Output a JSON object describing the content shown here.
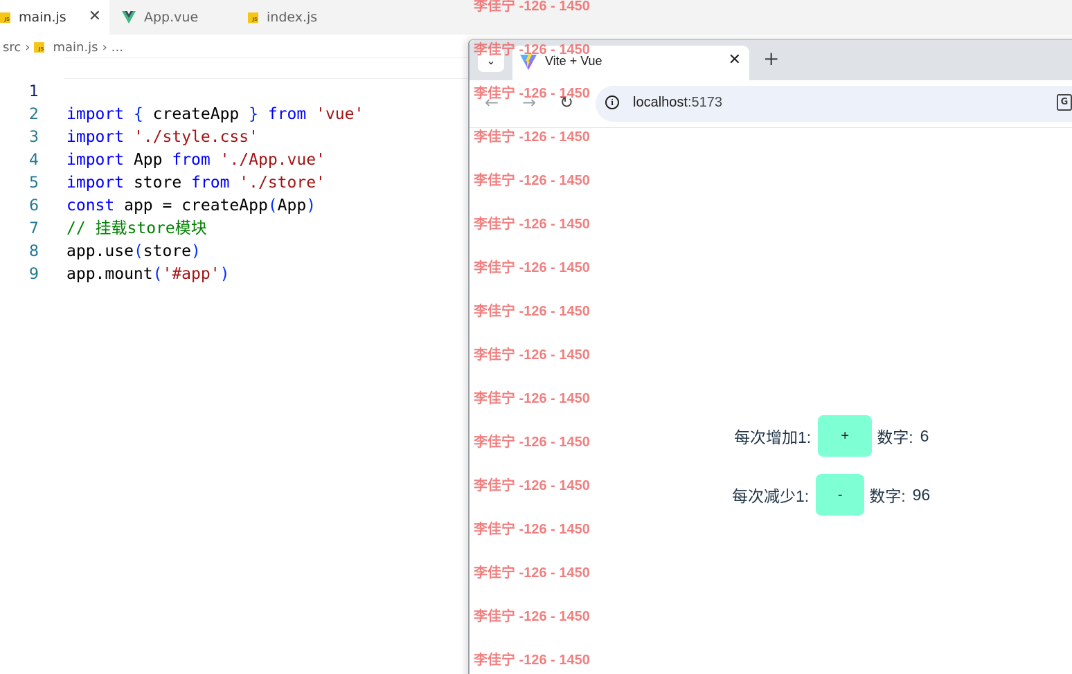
{
  "editor": {
    "tabs": [
      {
        "label": "main.js",
        "icon": "js-file-icon",
        "active": true
      },
      {
        "label": "App.vue",
        "icon": "vue-file-icon",
        "active": false
      },
      {
        "label": "index.js",
        "icon": "js-file-icon",
        "active": false
      }
    ],
    "breadcrumb": {
      "folder": "src",
      "file": "main.js",
      "more": "..."
    },
    "line_numbers": [
      "1",
      "2",
      "3",
      "4",
      "5",
      "6",
      "7",
      "8",
      "9"
    ],
    "code_lines": [
      "import { createApp } from 'vue'",
      "import './style.css'",
      "import App from './App.vue'",
      "import store from './store'",
      "const app = createApp(App)",
      "// 挂载store模块",
      "app.use(store)",
      "app.mount('#app')",
      ""
    ]
  },
  "browser": {
    "tab_title": "Vite + Vue",
    "url_host": "localhost",
    "url_port": ":5173",
    "new_tab_label": "+",
    "close_tab_label": "✕"
  },
  "watermark": {
    "text": "李佳宁 -126 - 1450",
    "count": 16
  },
  "app": {
    "increment": {
      "label": "每次增加1:",
      "button": "+",
      "value_label": "数字:",
      "value": "6"
    },
    "decrement": {
      "label": "每次减少1:",
      "button": "-",
      "value_label": "数字:",
      "value": "96"
    }
  },
  "colors": {
    "button_bg": "#7fffd4",
    "watermark": "#ec5c5c",
    "keyword": "#0000ff",
    "string": "#a31515",
    "comment": "#008000",
    "line_number": "#237893"
  }
}
